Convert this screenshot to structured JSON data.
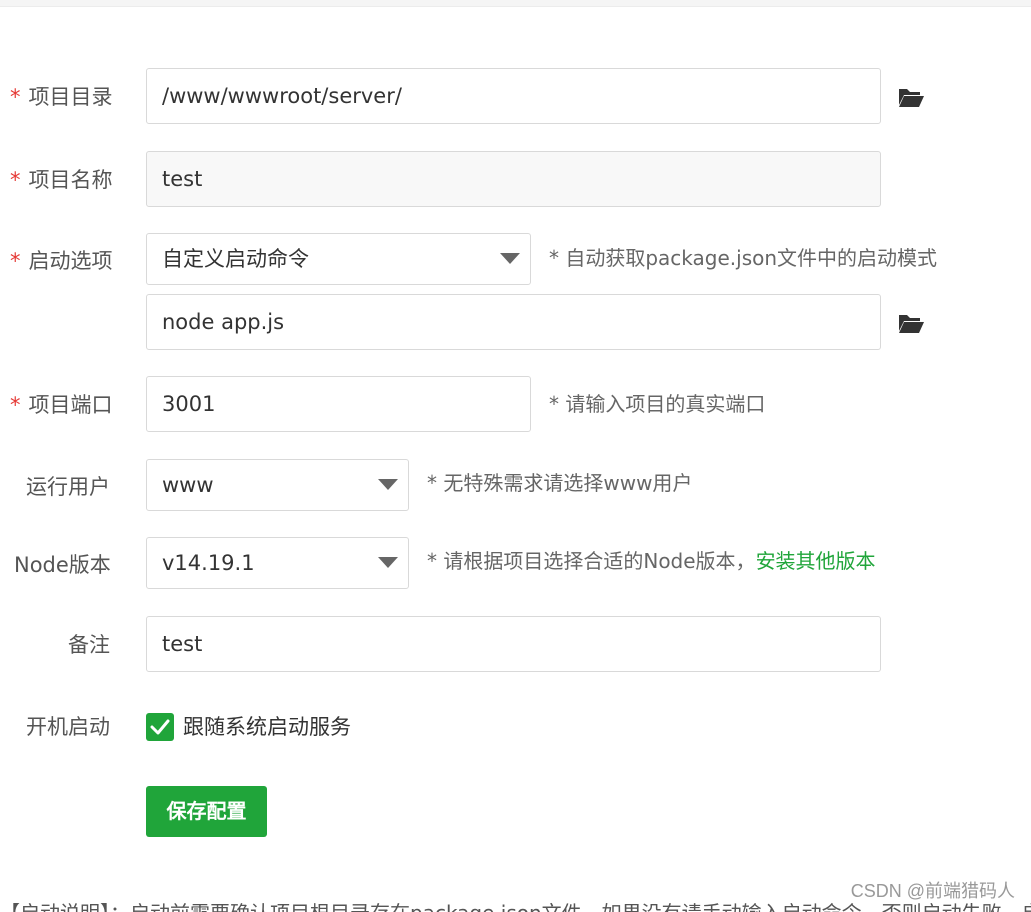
{
  "form": {
    "project_dir": {
      "label": "项目目录",
      "value": "/www/wwwroot/server/"
    },
    "project_name": {
      "label": "项目名称",
      "value": "test"
    },
    "start_option": {
      "label": "启动选项",
      "selected": "自定义启动命令",
      "hint": "* 自动获取package.json文件中的启动模式",
      "command": "node app.js"
    },
    "project_port": {
      "label": "项目端口",
      "value": "3001",
      "hint": "* 请输入项目的真实端口"
    },
    "run_user": {
      "label": "运行用户",
      "selected": "www",
      "hint": "* 无特殊需求请选择www用户"
    },
    "node_version": {
      "label": "Node版本",
      "selected": "v14.19.1",
      "hint": "* 请根据项目选择合适的Node版本，",
      "link": "安装其他版本"
    },
    "remark": {
      "label": "备注",
      "value": "test"
    },
    "autostart": {
      "label": "开机启动",
      "checked": true,
      "checkbox_label": "跟随系统启动服务"
    },
    "save_button": "保存配置"
  },
  "required_mark": "*",
  "bottom_text": "【启动说明】：启动前需要确认项目根目录存在package.json文件，如果没有请手动输入启动命令，否则启动失败，启动命令",
  "watermark": "CSDN @前端猎码人",
  "colors": {
    "accent": "#20a53a",
    "required": "#e53935"
  },
  "icons": {
    "folder": "folder-open-icon",
    "caret": "caret-down-icon",
    "check": "check-icon"
  }
}
